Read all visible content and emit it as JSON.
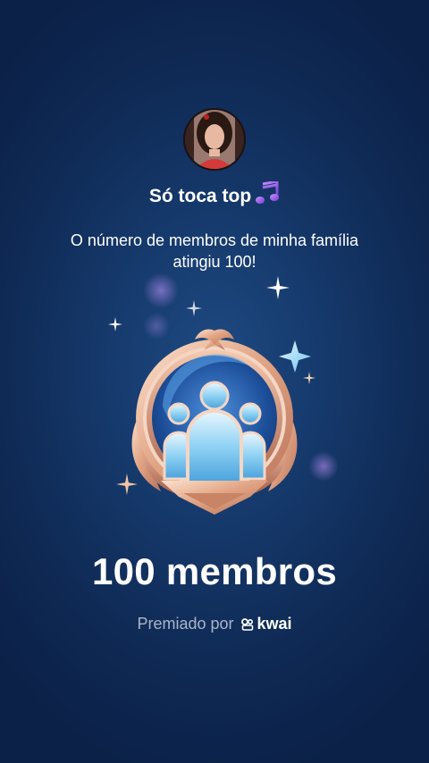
{
  "family": {
    "name": "Só toca top",
    "emoji_icon": "musical-notes-icon"
  },
  "message": "O número de membros de minha família atingiu 100!",
  "badge": {
    "icon": "family-members-badge-icon",
    "title": "100 membros"
  },
  "footer": {
    "awarded_by": "Premiado por",
    "brand": "kwai",
    "brand_icon": "kwai-logo-icon"
  },
  "colors": {
    "background": "#143869",
    "badge_rose_gold": "#e8b49a",
    "badge_blue": "#7fc8ef",
    "caption_gray": "#aab6c8"
  }
}
